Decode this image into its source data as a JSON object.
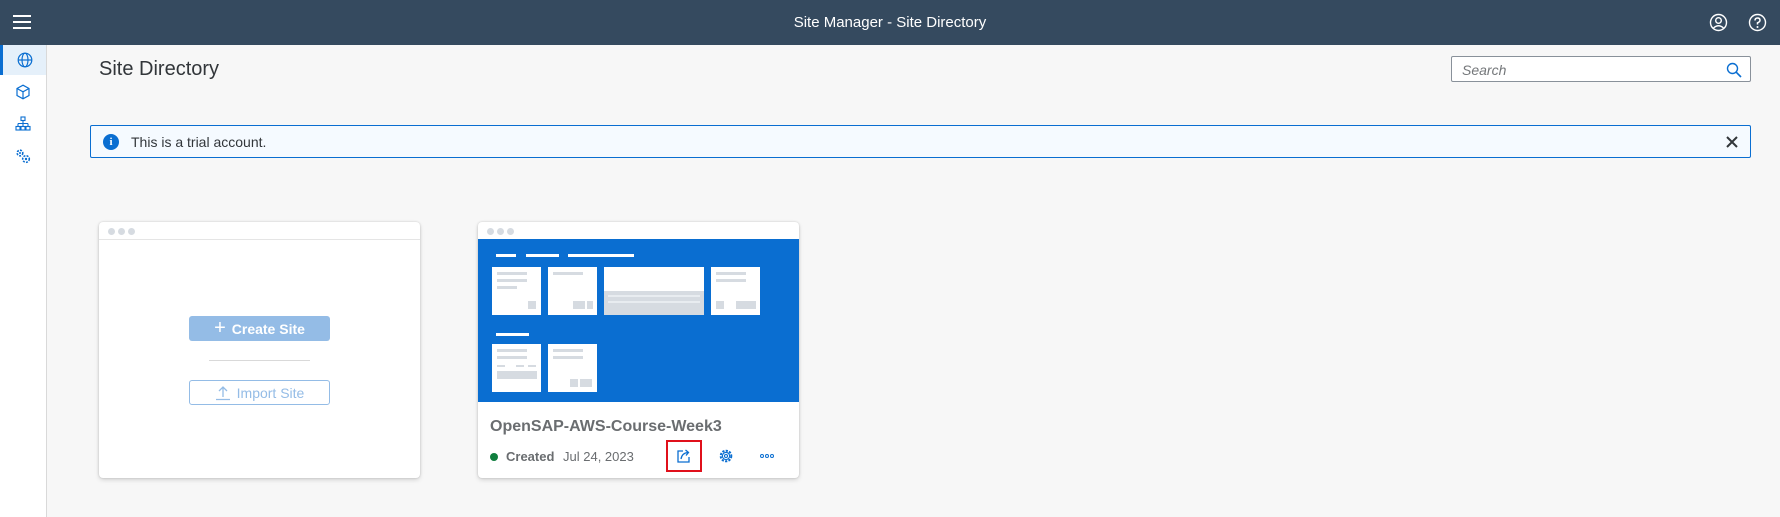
{
  "shell": {
    "title": "Site Manager - Site Directory"
  },
  "sidenav": {
    "items": [
      {
        "icon": "globe-icon",
        "label": "Site Directory",
        "active": true
      },
      {
        "icon": "cube-icon",
        "label": "Content",
        "active": false
      },
      {
        "icon": "hierarchy-icon",
        "label": "Structure",
        "active": false
      },
      {
        "icon": "gears-icon",
        "label": "Settings",
        "active": false
      }
    ]
  },
  "page": {
    "title": "Site Directory"
  },
  "search": {
    "placeholder": "Search",
    "value": ""
  },
  "info_strip": {
    "text": "This is a trial account."
  },
  "create_card": {
    "create_label": "Create Site",
    "import_label": "Import Site"
  },
  "site_card": {
    "name": "OpenSAP-AWS-Course-Week3",
    "status": "Created",
    "date": "Jul 24, 2023",
    "status_color": "#107e3e"
  },
  "colors": {
    "shell": "#354a5f",
    "accent": "#0a6ed1",
    "highlight": "#e0101b"
  }
}
